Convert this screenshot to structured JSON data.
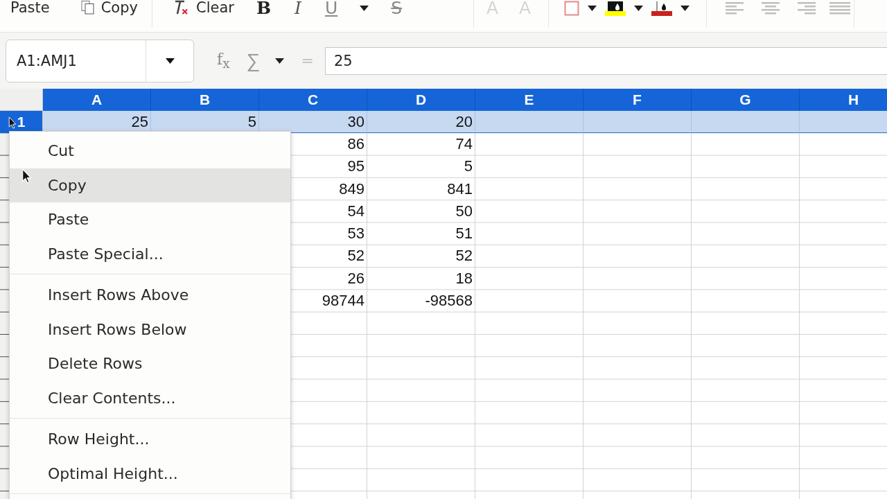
{
  "toolbar": {
    "groups": [
      {
        "items": [
          {
            "kind": "paste",
            "label": "Paste",
            "disabled": false
          },
          {
            "kind": "copy",
            "label": "Copy",
            "disabled": false
          }
        ]
      },
      {
        "items": [
          {
            "kind": "clear",
            "label": "Clear",
            "disabled": false
          },
          {
            "kind": "bold",
            "label": "B",
            "disabled": false
          },
          {
            "kind": "italic",
            "label": "I",
            "disabled": false
          },
          {
            "kind": "underline",
            "label": "U",
            "disabled": false
          },
          {
            "kind": "strikethrough",
            "label": "S",
            "disabled": false
          }
        ]
      },
      {
        "items": [
          {
            "kind": "subscript",
            "label": "A",
            "disabled": true
          },
          {
            "kind": "superscript",
            "label": "A",
            "disabled": true
          }
        ]
      },
      {
        "items": [
          {
            "kind": "border",
            "disabled": false
          },
          {
            "kind": "highlight",
            "color": "#ffff00",
            "disabled": false
          },
          {
            "kind": "font-color",
            "color": "#c9211e",
            "disabled": false
          }
        ]
      },
      {
        "items": [
          {
            "kind": "align-left",
            "disabled": true
          },
          {
            "kind": "align-center",
            "disabled": true
          },
          {
            "kind": "align-right",
            "disabled": true
          },
          {
            "kind": "justify",
            "disabled": true
          }
        ]
      }
    ]
  },
  "formula_bar": {
    "name_box": "A1:AMJ1",
    "function_icon": "f$_{x}$",
    "sum_icon": "∑",
    "equals": "=",
    "input": "25"
  },
  "sheet": {
    "columns": [
      {
        "label": "A",
        "selected": true,
        "cells": [
          "25"
        ]
      },
      {
        "label": "B",
        "selected": true,
        "cells": [
          "5"
        ]
      },
      {
        "label": "C",
        "selected": true,
        "cells": [
          "30",
          "86",
          "95",
          "849",
          "54",
          "53",
          "52",
          "26",
          "98744"
        ]
      },
      {
        "label": "D",
        "selected": true,
        "cells": [
          "20",
          "74",
          "5",
          "841",
          "50",
          "51",
          "52",
          "18",
          "-98568"
        ]
      },
      {
        "label": "E",
        "selected": true
      },
      {
        "label": "F",
        "selected": true
      },
      {
        "label": "G",
        "selected": true
      },
      {
        "label": "H",
        "selected": true
      }
    ],
    "rows": [
      {
        "label": "1",
        "selected": true
      }
    ]
  },
  "context_menu": {
    "groups": [
      {
        "items": [
          {
            "label": "Cut",
            "selected": false
          },
          {
            "label": "Copy",
            "selected": true
          },
          {
            "label": "Paste",
            "selected": false
          },
          {
            "label": "Paste Special...",
            "selected": false
          }
        ]
      },
      {
        "items": [
          {
            "label": "Insert Rows Above",
            "selected": false
          },
          {
            "label": "Insert Rows Below",
            "selected": false
          },
          {
            "label": "Delete Rows",
            "selected": false
          },
          {
            "label": "Clear Contents...",
            "selected": false
          }
        ]
      },
      {
        "items": [
          {
            "label": "Row Height...",
            "selected": false
          },
          {
            "label": "Optimal Height...",
            "selected": false
          }
        ]
      }
    ]
  }
}
